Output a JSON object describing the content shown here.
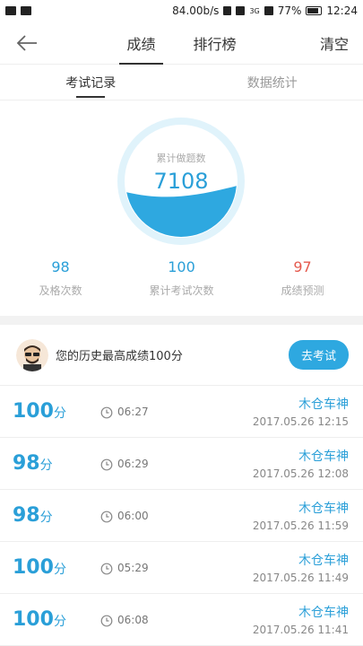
{
  "status_bar": {
    "speed": "84.00b/s",
    "network": "3G",
    "battery": "77%",
    "time": "12:24"
  },
  "nav": {
    "tabs": [
      "成绩",
      "排行榜"
    ],
    "active_tab": "成绩",
    "clear_label": "清空"
  },
  "sub_tabs": {
    "items": [
      "考试记录",
      "数据统计"
    ],
    "active": "考试记录"
  },
  "gauge": {
    "label": "累计做题数",
    "value": "7108",
    "fill_fraction": 0.4,
    "fill_color": "#2ea8e0",
    "ring_color": "#e0f3fb"
  },
  "stats": [
    {
      "value": "98",
      "label": "及格次数",
      "color": "#2a9fd8"
    },
    {
      "value": "100",
      "label": "累计考试次数",
      "color": "#2a9fd8"
    },
    {
      "value": "97",
      "label": "成绩预测",
      "color": "#e55a4e"
    }
  ],
  "best": {
    "text": "您的历史最高成绩100分",
    "button_label": "去考试"
  },
  "records": [
    {
      "score": "100",
      "unit": "分",
      "duration": "06:27",
      "user": "木仓车神",
      "datetime": "2017.05.26  12:15"
    },
    {
      "score": "98",
      "unit": "分",
      "duration": "06:29",
      "user": "木仓车神",
      "datetime": "2017.05.26  12:08"
    },
    {
      "score": "98",
      "unit": "分",
      "duration": "06:00",
      "user": "木仓车神",
      "datetime": "2017.05.26  11:59"
    },
    {
      "score": "100",
      "unit": "分",
      "duration": "05:29",
      "user": "木仓车神",
      "datetime": "2017.05.26  11:49"
    },
    {
      "score": "100",
      "unit": "分",
      "duration": "06:08",
      "user": "木仓车神",
      "datetime": "2017.05.26  11:41"
    }
  ]
}
